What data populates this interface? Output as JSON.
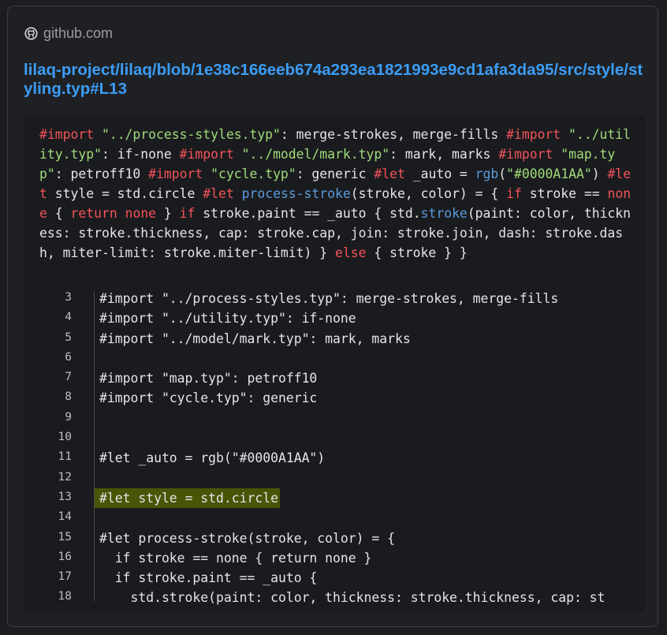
{
  "site": {
    "name": "github.com",
    "icon": "github-icon"
  },
  "link": {
    "text": "lilaq-project/lilaq/blob/1e38c166eeb674a293ea1821993e9cd1afa3da95/src/style/styling.typ#L13"
  },
  "flat_code": [
    {
      "t": "#import",
      "c": "kw"
    },
    {
      "t": " ",
      "c": ""
    },
    {
      "t": "\"../process-styles.typ\"",
      "c": "str"
    },
    {
      "t": ": merge-strokes, merge-fills ",
      "c": ""
    },
    {
      "t": "#import",
      "c": "kw"
    },
    {
      "t": " ",
      "c": ""
    },
    {
      "t": "\"../utility.typ\"",
      "c": "str"
    },
    {
      "t": ": if-none ",
      "c": ""
    },
    {
      "t": "#import",
      "c": "kw"
    },
    {
      "t": " ",
      "c": ""
    },
    {
      "t": "\"../model/mark.typ\"",
      "c": "str"
    },
    {
      "t": ": mark, marks ",
      "c": ""
    },
    {
      "t": "#import",
      "c": "kw"
    },
    {
      "t": " ",
      "c": ""
    },
    {
      "t": "\"map.typ\"",
      "c": "str"
    },
    {
      "t": ": petroff10 ",
      "c": ""
    },
    {
      "t": "#import",
      "c": "kw"
    },
    {
      "t": " ",
      "c": ""
    },
    {
      "t": "\"cycle.typ\"",
      "c": "str"
    },
    {
      "t": ": generic ",
      "c": ""
    },
    {
      "t": "#let",
      "c": "kw"
    },
    {
      "t": " _auto = ",
      "c": ""
    },
    {
      "t": "rgb",
      "c": "fn"
    },
    {
      "t": "(",
      "c": ""
    },
    {
      "t": "\"#0000A1AA\"",
      "c": "str"
    },
    {
      "t": ") ",
      "c": ""
    },
    {
      "t": "#let",
      "c": "kw"
    },
    {
      "t": " style = std.circle ",
      "c": ""
    },
    {
      "t": "#let",
      "c": "kw"
    },
    {
      "t": " ",
      "c": ""
    },
    {
      "t": "process-stroke",
      "c": "fn"
    },
    {
      "t": "(stroke, color) = { ",
      "c": ""
    },
    {
      "t": "if",
      "c": "kw"
    },
    {
      "t": " stroke == ",
      "c": ""
    },
    {
      "t": "none",
      "c": "kw"
    },
    {
      "t": " { ",
      "c": ""
    },
    {
      "t": "return",
      "c": "kw"
    },
    {
      "t": " ",
      "c": ""
    },
    {
      "t": "none",
      "c": "kw"
    },
    {
      "t": " } ",
      "c": ""
    },
    {
      "t": "if",
      "c": "kw"
    },
    {
      "t": " stroke.paint == _auto { std.",
      "c": ""
    },
    {
      "t": "stroke",
      "c": "fn"
    },
    {
      "t": "(paint: color, thickness: stroke.thickness, cap: stroke.cap, join: stroke.join, dash: stroke.dash, miter-limit: stroke.miter-limit) } ",
      "c": ""
    },
    {
      "t": "else",
      "c": "kw"
    },
    {
      "t": " { stroke } }",
      "c": ""
    }
  ],
  "code_lines": [
    {
      "n": "3",
      "text": "#import \"../process-styles.typ\": merge-strokes, merge-fills"
    },
    {
      "n": "4",
      "text": "#import \"../utility.typ\": if-none"
    },
    {
      "n": "5",
      "text": "#import \"../model/mark.typ\": mark, marks"
    },
    {
      "n": "6",
      "text": ""
    },
    {
      "n": "7",
      "text": "#import \"map.typ\": petroff10"
    },
    {
      "n": "8",
      "text": "#import \"cycle.typ\": generic"
    },
    {
      "n": "9",
      "text": ""
    },
    {
      "n": "10",
      "text": ""
    },
    {
      "n": "11",
      "text": "#let _auto = rgb(\"#0000A1AA\")"
    },
    {
      "n": "12",
      "text": ""
    },
    {
      "n": "13",
      "text": "#let style = std.circle",
      "highlight": true
    },
    {
      "n": "14",
      "text": ""
    },
    {
      "n": "15",
      "text": "#let process-stroke(stroke, color) = {"
    },
    {
      "n": "16",
      "text": "  if stroke == none { return none }"
    },
    {
      "n": "17",
      "text": "  if stroke.paint == _auto {"
    },
    {
      "n": "18",
      "text": "    std.stroke(paint: color, thickness: stroke.thickness, cap: st"
    }
  ]
}
